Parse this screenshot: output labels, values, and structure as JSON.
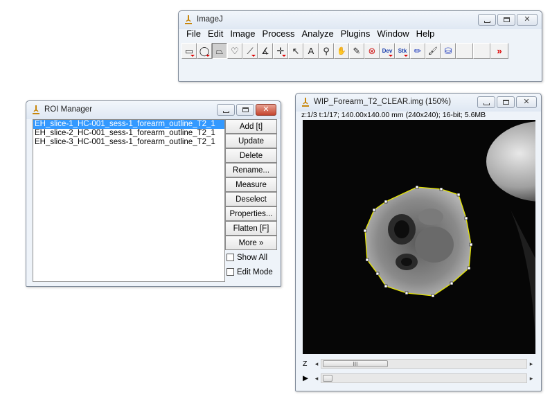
{
  "imagej": {
    "title": "ImageJ",
    "menus": [
      "File",
      "Edit",
      "Image",
      "Process",
      "Analyze",
      "Plugins",
      "Window",
      "Help"
    ],
    "tools": [
      {
        "name": "rectangle-tool-icon",
        "glyph": "▭"
      },
      {
        "name": "oval-tool-icon",
        "glyph": "◯"
      },
      {
        "name": "polygon-tool-icon",
        "glyph": "⏢"
      },
      {
        "name": "freehand-tool-icon",
        "glyph": "♡"
      },
      {
        "name": "line-tool-icon",
        "glyph": "⟋"
      },
      {
        "name": "angle-tool-icon",
        "glyph": "∡"
      },
      {
        "name": "point-tool-icon",
        "glyph": "✛"
      },
      {
        "name": "wand-tool-icon",
        "glyph": "↖"
      },
      {
        "name": "text-tool-icon",
        "glyph": "A"
      },
      {
        "name": "magnifier-tool-icon",
        "glyph": "⚲"
      },
      {
        "name": "hand-tool-icon",
        "glyph": "✋"
      },
      {
        "name": "dropper-tool-icon",
        "glyph": "✎"
      },
      {
        "name": "cancel-tool-icon",
        "glyph": "⊗"
      },
      {
        "name": "dev-tool-icon",
        "glyph": "Dev"
      },
      {
        "name": "stk-tool-icon",
        "glyph": "Stk"
      },
      {
        "name": "pencil-tool-icon",
        "glyph": "✏"
      },
      {
        "name": "brush-tool-icon",
        "glyph": "🖌"
      },
      {
        "name": "flood-fill-tool-icon",
        "glyph": "⛁"
      }
    ],
    "more_tools": "»"
  },
  "roi_manager": {
    "title": "ROI Manager",
    "items": [
      "EH_slice-1_HC-001_sess-1_forearm_outline_T2_1",
      "EH_slice-2_HC-001_sess-1_forearm_outline_T2_1",
      "EH_slice-3_HC-001_sess-1_forearm_outline_T2_1"
    ],
    "buttons": [
      "Add [t]",
      "Update",
      "Delete",
      "Rename...",
      "Measure",
      "Deselect",
      "Properties...",
      "Flatten [F]",
      "More »"
    ],
    "checkboxes": [
      "Show All",
      "Edit Mode"
    ]
  },
  "image_window": {
    "title": "WIP_Forearm_T2_CLEAR.img (150%)",
    "info": "z:1/3 t:1/17; 140.00x140.00 mm (240x240); 16-bit; 5.6MB",
    "z_label": "Z",
    "t_label": "▶",
    "z_thumb": "III"
  },
  "colors": {
    "selection": "#3399ff",
    "roi_outline": "#e6e600"
  }
}
